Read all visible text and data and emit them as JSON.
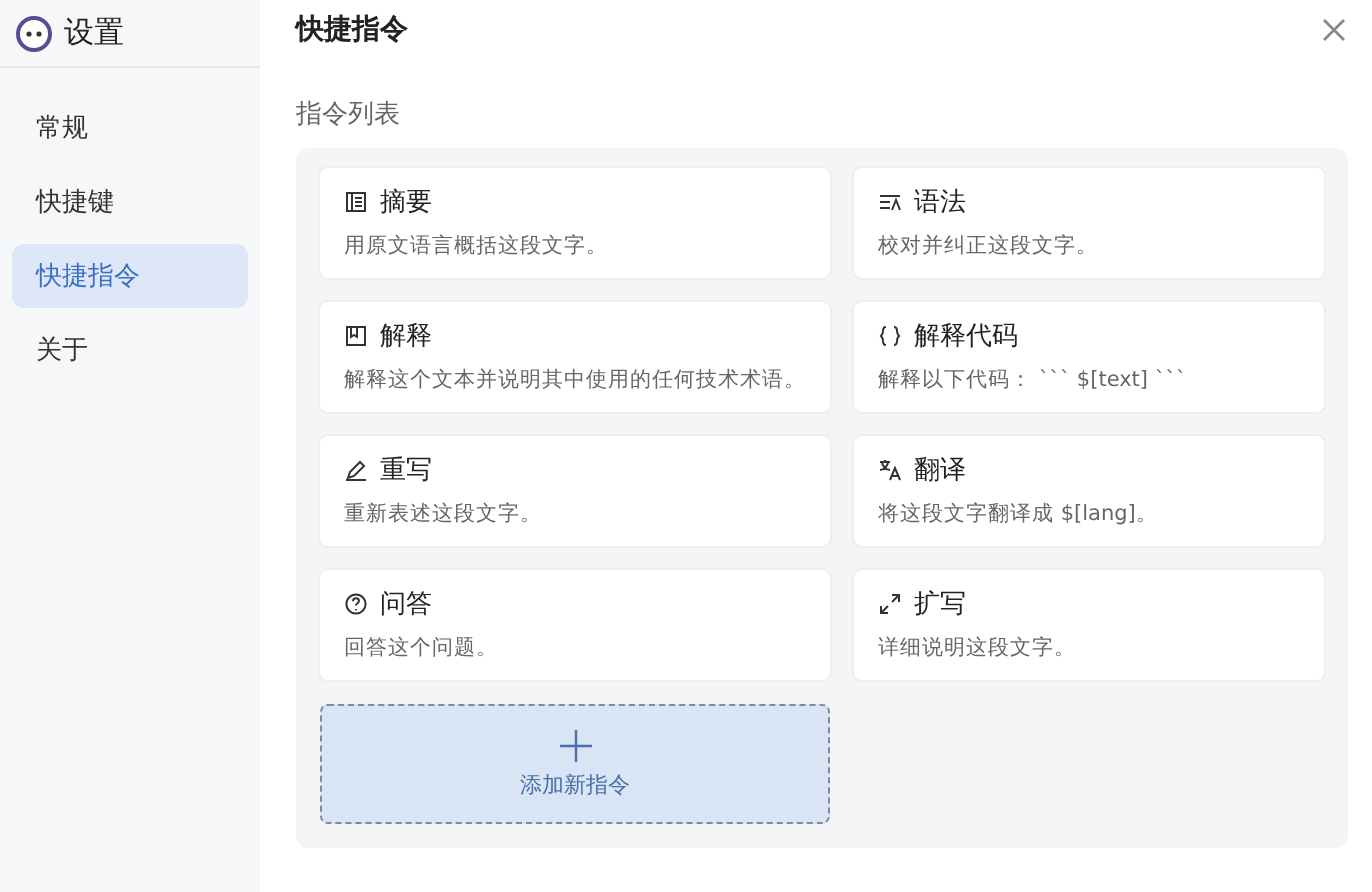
{
  "sidebar": {
    "title": "设置",
    "items": [
      {
        "label": "常规",
        "selected": false
      },
      {
        "label": "快捷键",
        "selected": false
      },
      {
        "label": "快捷指令",
        "selected": true
      },
      {
        "label": "关于",
        "selected": false
      }
    ]
  },
  "page": {
    "title": "快捷指令",
    "section": "指令列表"
  },
  "commands": [
    {
      "name": "摘要",
      "description": "用原文语言概括这段文字。"
    },
    {
      "name": "语法",
      "description": "校对并纠正这段文字。"
    },
    {
      "name": "解释",
      "description": "解释这个文本并说明其中使用的任何技术术语。"
    },
    {
      "name": "解释代码",
      "description": "解释以下代码： ``` $[text] ```"
    },
    {
      "name": "重写",
      "description": "重新表述这段文字。"
    },
    {
      "name": "翻译",
      "description": "将这段文字翻译成 $[lang]。"
    },
    {
      "name": "问答",
      "description": "回答这个问题。"
    },
    {
      "name": "扩写",
      "description": "详细说明这段文字。"
    }
  ],
  "add_button": {
    "label": "添加新指令"
  }
}
